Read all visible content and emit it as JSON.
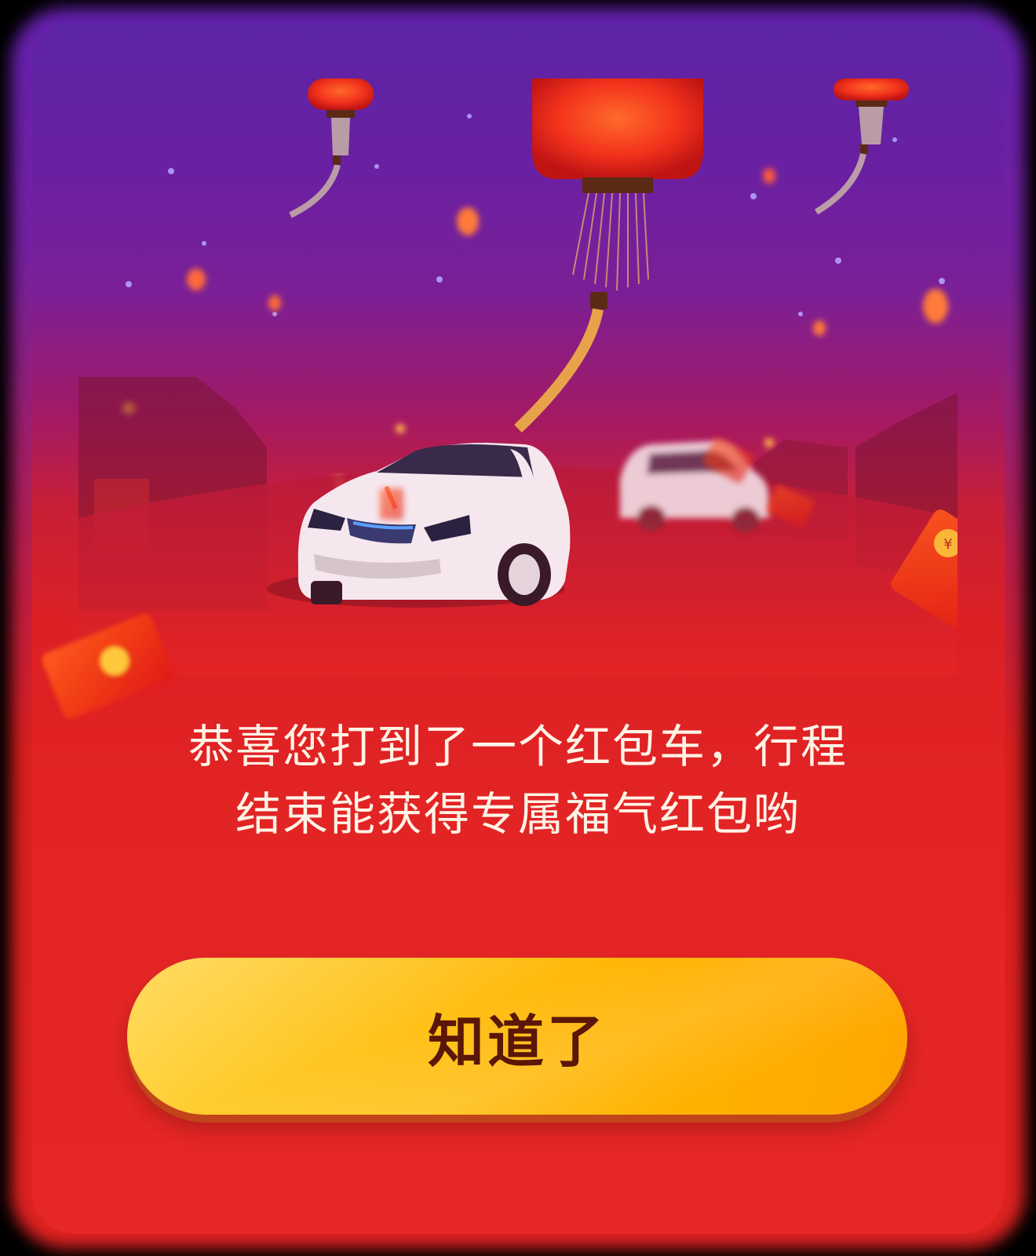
{
  "dialog": {
    "message_lines": [
      "恭喜您打到了一个红包车，行程",
      "结束能获得专属福气红包哟"
    ],
    "confirm_button_label": "知道了"
  },
  "colors": {
    "sky_top": "#5d24a6",
    "background_red": "#e42525",
    "button_yellow": "#ffc21a",
    "button_text": "#5a1606",
    "message_text": "#fff3e6"
  },
  "decor": {
    "lantern": "lantern-icon",
    "car": "car-icon",
    "red_envelope": "red-envelope-icon"
  }
}
